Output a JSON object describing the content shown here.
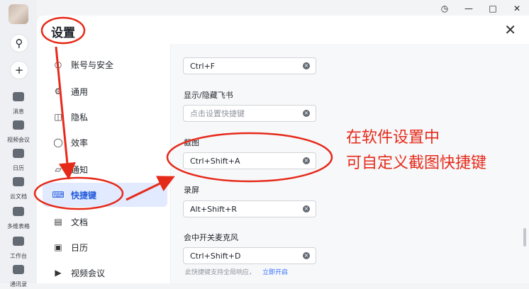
{
  "window": {
    "title": "设置"
  },
  "rail": {
    "items": [
      {
        "label": "消息",
        "icon": "chat-icon"
      },
      {
        "label": "视频会议",
        "icon": "video-icon"
      },
      {
        "label": "日历",
        "icon": "calendar-icon"
      },
      {
        "label": "云文档",
        "icon": "cloud-doc-icon"
      },
      {
        "label": "多维表格",
        "icon": "base-table-icon"
      },
      {
        "label": "工作台",
        "icon": "workplace-icon"
      },
      {
        "label": "通讯录",
        "icon": "contacts-icon"
      }
    ]
  },
  "sidebar": {
    "items": [
      {
        "label": "账号与安全",
        "icon": "user-icon"
      },
      {
        "label": "通用",
        "icon": "gear-icon"
      },
      {
        "label": "隐私",
        "icon": "shield-icon"
      },
      {
        "label": "效率",
        "icon": "lightbulb-icon"
      },
      {
        "label": "通知",
        "icon": "bell-icon"
      },
      {
        "label": "快捷键",
        "icon": "keyboard-icon",
        "active": true
      },
      {
        "label": "文档",
        "icon": "document-icon"
      },
      {
        "label": "日历",
        "icon": "calendar-icon"
      },
      {
        "label": "视频会议",
        "icon": "video-icon"
      }
    ]
  },
  "shortcuts": {
    "search_value": "Ctrl+F",
    "show_hide": {
      "label": "显示/隐藏飞书",
      "placeholder": "点击设置快捷键"
    },
    "screenshot": {
      "label": "截图",
      "value": "Ctrl+Shift+A"
    },
    "record": {
      "label": "录屏",
      "value": "Alt+Shift+R"
    },
    "mic": {
      "label": "会中开关麦克风",
      "value": "Ctrl+Shift+D"
    },
    "hint": {
      "text": "此快捷键支持全局响应，",
      "link": "立即开启"
    }
  },
  "annotation": {
    "line1": "在软件设置中",
    "line2": "可自定义截图快捷键"
  },
  "colors": {
    "accent": "#3370ff",
    "annotation": "#e62a1a"
  }
}
